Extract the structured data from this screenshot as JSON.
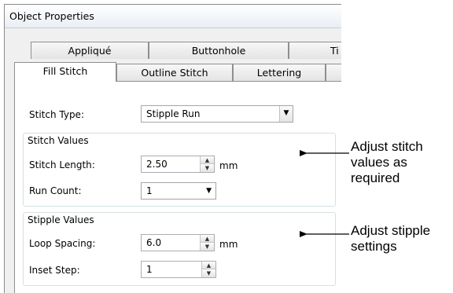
{
  "window": {
    "title": "Object Properties"
  },
  "tabs_back": [
    {
      "label": "Appliqué"
    },
    {
      "label": "Buttonhole"
    },
    {
      "label": "Ti"
    }
  ],
  "tabs_front": [
    {
      "label": "Fill Stitch",
      "active": true
    },
    {
      "label": "Outline Stitch"
    },
    {
      "label": "Lettering"
    }
  ],
  "form": {
    "stitch_type_label": "Stitch Type:",
    "stitch_type_value": "Stipple Run",
    "stitch_values_title": "Stitch Values",
    "stitch_length_label": "Stitch Length:",
    "stitch_length_value": "2.50",
    "stitch_length_unit": "mm",
    "run_count_label": "Run Count:",
    "run_count_value": "1",
    "stipple_values_title": "Stipple Values",
    "loop_spacing_label": "Loop Spacing:",
    "loop_spacing_value": "6.0",
    "loop_spacing_unit": "mm",
    "inset_step_label": "Inset Step:",
    "inset_step_value": "1"
  },
  "annotations": {
    "stitch_line1": "Adjust stitch",
    "stitch_line2": "values as",
    "stitch_line3": "required",
    "stipple_line1": "Adjust stipple",
    "stipple_line2": "settings"
  }
}
